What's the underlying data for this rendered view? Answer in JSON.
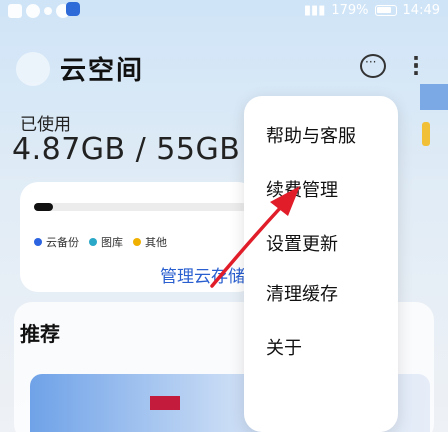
{
  "status_bar": {
    "battery_text": "179%",
    "time": "14:49"
  },
  "header": {
    "title": "云空间"
  },
  "storage": {
    "used_label": "已使用",
    "value_text": "4.87GB / 55GB",
    "used_fraction": 0.088,
    "legend": [
      {
        "label": "云备份",
        "color": "#2b63e0"
      },
      {
        "label": "图库",
        "color": "#2aa8c8"
      },
      {
        "label": "其他",
        "color": "#f0b000"
      }
    ],
    "manage_label": "管理云存储"
  },
  "recommend": {
    "title": "推荐"
  },
  "menu": {
    "items": [
      {
        "label": "帮助与客服"
      },
      {
        "label": "续费管理"
      },
      {
        "label": "设置更新"
      },
      {
        "label": "清理缓存"
      },
      {
        "label": "关于"
      }
    ]
  },
  "colors": {
    "accent": "#2a5fd0",
    "annotation": "#e11d2a"
  }
}
